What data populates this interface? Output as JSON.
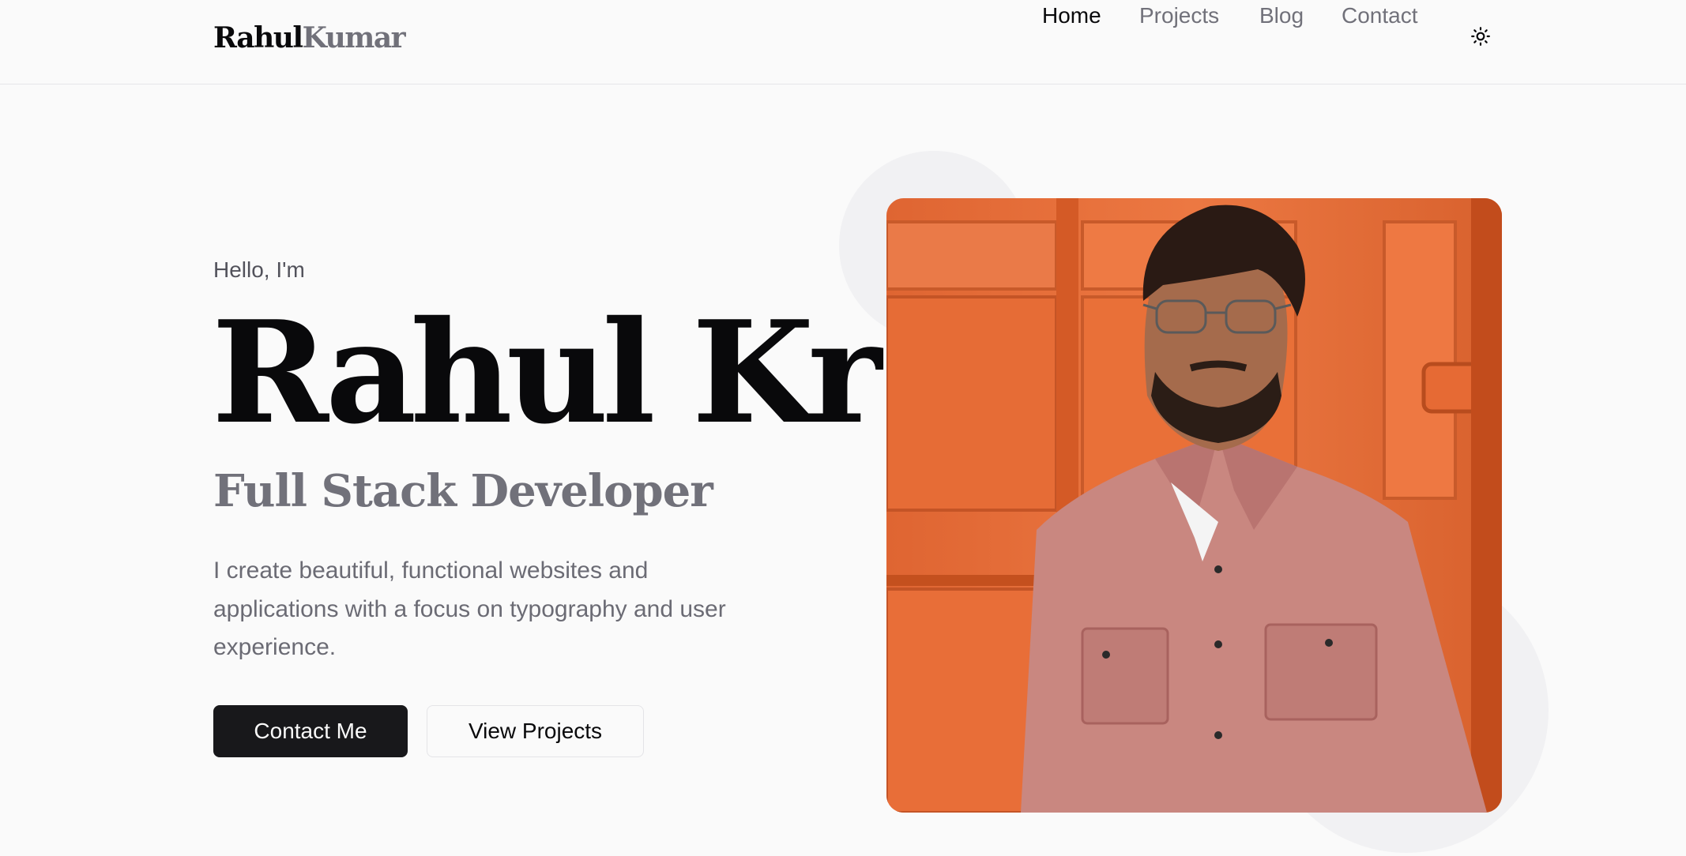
{
  "header": {
    "logo_first": "Rahul",
    "logo_last": "Kumar",
    "nav": [
      {
        "label": "Home",
        "active": true
      },
      {
        "label": "Projects",
        "active": false
      },
      {
        "label": "Blog",
        "active": false
      },
      {
        "label": "Contact",
        "active": false
      }
    ],
    "theme_toggle_icon": "sun-icon"
  },
  "hero": {
    "greeting": "Hello, I'm",
    "name": "Rahul Kr",
    "role": "Full Stack Developer",
    "description": "I create beautiful, functional websites and applications with a focus on typography and user experience.",
    "primary_button": "Contact Me",
    "secondary_button": "View Projects",
    "portrait_icon": "profile-photo"
  },
  "colors": {
    "background": "#fafafa",
    "text_primary": "#09090b",
    "text_muted": "#71717a",
    "primary_button_bg": "#18181b",
    "photo_backdrop": "#e8703c",
    "shirt": "#c98780"
  }
}
